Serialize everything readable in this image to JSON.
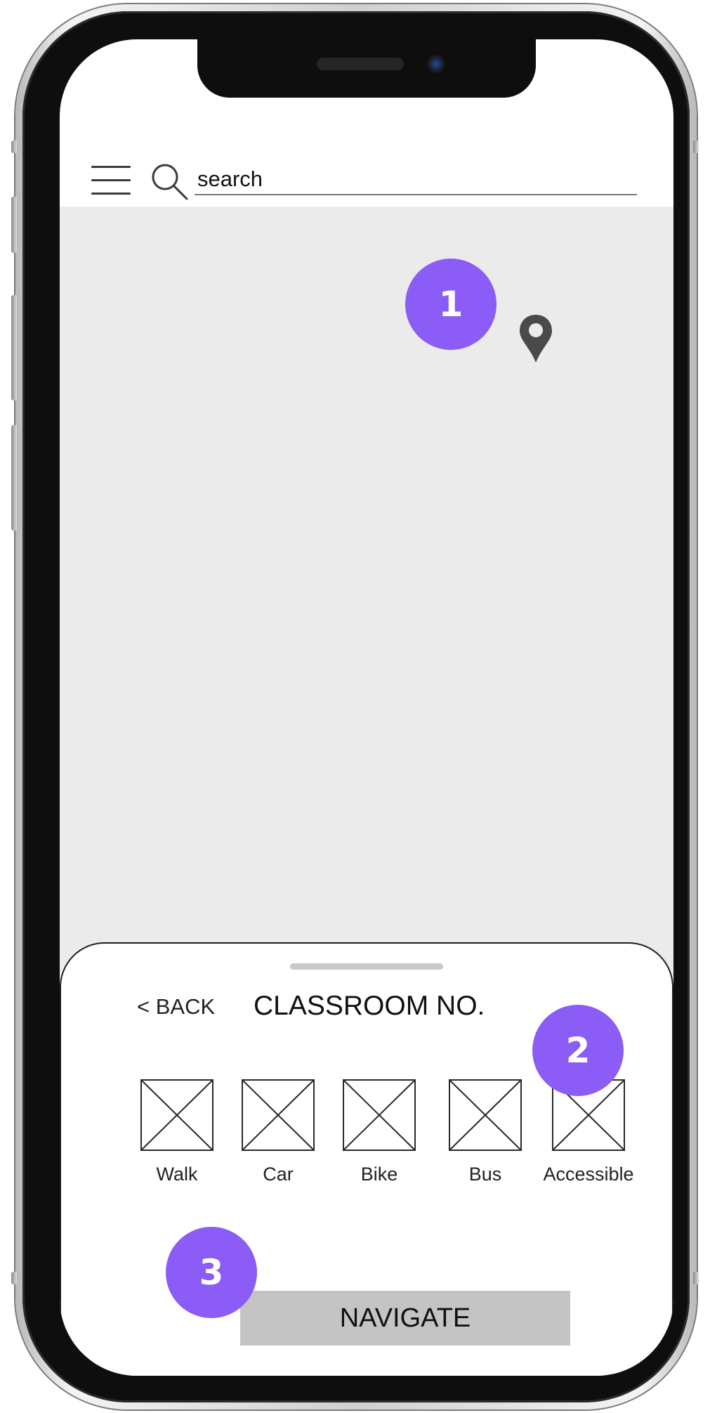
{
  "header": {
    "search_placeholder": "search"
  },
  "sheet": {
    "back_label": "< BACK",
    "title": "CLASSROOM NO.",
    "modes": [
      {
        "label": "Walk"
      },
      {
        "label": "Car"
      },
      {
        "label": "Bike"
      },
      {
        "label": "Bus"
      },
      {
        "label": "Accessible"
      }
    ],
    "navigate_label": "NAVIGATE"
  },
  "markers": [
    "1",
    "2",
    "3"
  ],
  "colors": {
    "marker": "#8b5cf6",
    "map_background": "#ebebeb",
    "navigate_button": "#c4c4c4",
    "sheet_handle": "#c8c8c8"
  },
  "icons": {
    "menu": "hamburger-menu-icon",
    "search": "search-icon",
    "location": "map-pin-icon",
    "mode_placeholder": "image-placeholder-icon"
  }
}
